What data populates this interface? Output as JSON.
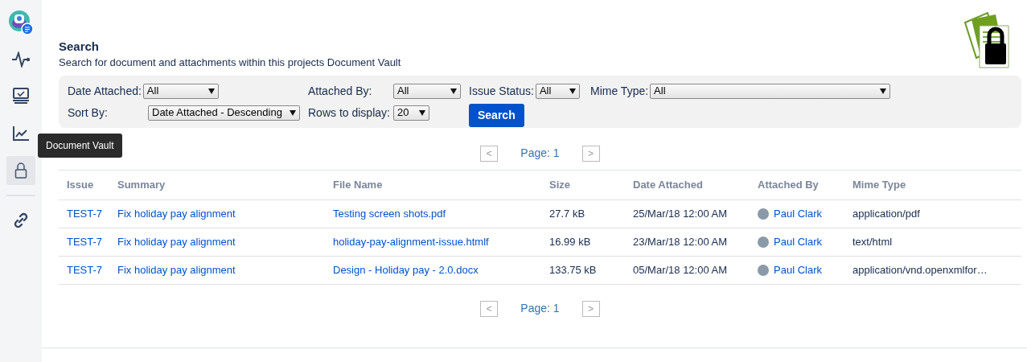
{
  "sidebar": {
    "items": [
      {
        "selected": false
      },
      {
        "selected": false
      },
      {
        "selected": false
      },
      {
        "selected": false
      },
      {
        "selected": true
      },
      {
        "selected": false
      }
    ],
    "tooltip": "Document Vault"
  },
  "header": {
    "title": "Search",
    "subtitle": "Search for document and attachments within this projects Document Vault"
  },
  "filters": {
    "rows": [
      [
        {
          "label": "Date Attached:",
          "value": "All"
        },
        {
          "label": "Attached By:",
          "value": "All"
        },
        {
          "label": "Issue Status:",
          "value": "All"
        },
        {
          "label": "Mime Type:",
          "value": "All"
        }
      ],
      [
        {
          "label": "Sort By:",
          "value": "Date Attached - Descending"
        },
        {
          "label": "Rows to display:",
          "value": "20"
        }
      ]
    ],
    "search_button": "Search"
  },
  "pagination_top": {
    "prev": "<",
    "page": "Page: 1",
    "next": ">"
  },
  "table": {
    "columns": [
      "Issue",
      "Summary",
      "File Name",
      "Size",
      "Date Attached",
      "Attached By",
      "Mime Type"
    ],
    "rows": [
      [
        "TEST-7",
        "Fix holiday pay alignment",
        "Testing screen shots.pdf",
        "27.7 kB",
        "25/Mar/18 12:00 AM",
        "Paul Clark",
        "application/pdf"
      ],
      [
        "TEST-7",
        "Fix holiday pay alignment",
        "holiday-pay-alignment-issue.htmlf",
        "16.99 kB",
        "23/Mar/18 12:00 AM",
        "Paul Clark",
        "text/html"
      ],
      [
        "TEST-7",
        "Fix holiday pay alignment",
        "Design - Holiday pay - 2.0.docx",
        "133.75 kB",
        "05/Mar/18 12:00 AM",
        "Paul Clark",
        "application/vnd.openxmlfor…"
      ]
    ]
  },
  "pagination_bottom": {
    "prev": "<",
    "page": "Page: 1",
    "next": ">"
  }
}
